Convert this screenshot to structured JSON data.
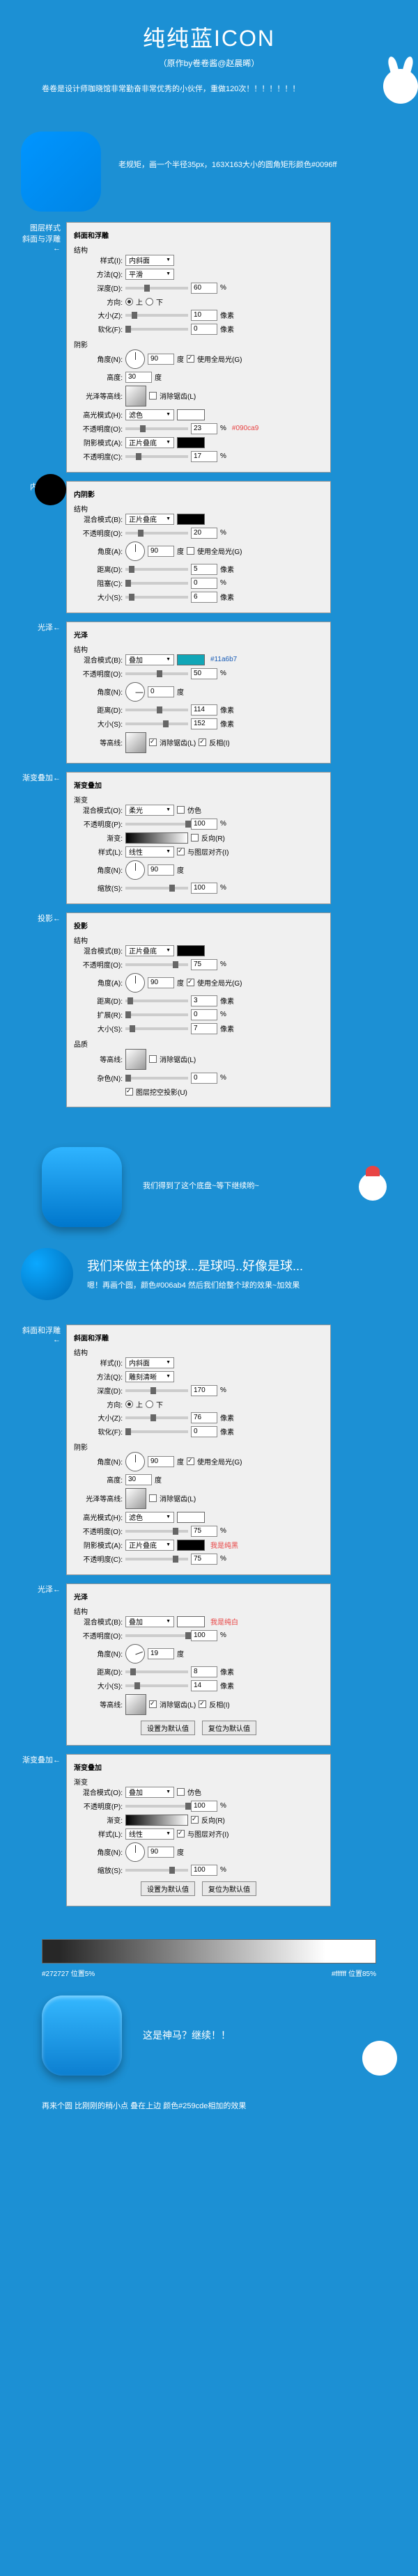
{
  "header": {
    "title": "纯纯蓝ICON",
    "subtitle": "（原作by卷卷酱@赵晨晞）"
  },
  "intro": {
    "text": "卷卷是设计师咖晓馆非常勤奋非常优秀的小伙伴，重做120次！！！！！！！"
  },
  "step1": {
    "desc": "老规矩，画一个半径35px，163X163大小的圆角矩形颜色#0096ff"
  },
  "labels": {
    "bevel": "图层样式\n斜面与浮雕←",
    "inner": "内阴影←",
    "glow": "光泽←",
    "grad": "渐变叠加←",
    "drop": "投影←",
    "bevel2": "斜面和浮雕←",
    "glow2": "光泽←",
    "grad2": "渐变叠加←"
  },
  "panel_bevel": {
    "title": "斜面和浮雕",
    "sec1": "结构",
    "style_l": "样式(I):",
    "style_v": "内斜面",
    "method_l": "方法(Q):",
    "method_v": "平滑",
    "depth_l": "深度(D):",
    "depth_v": "60",
    "depth_u": "%",
    "dir_l": "方向:",
    "up": "上",
    "down": "下",
    "size_l": "大小(Z):",
    "size_v": "10",
    "size_u": "像素",
    "soft_l": "软化(F):",
    "soft_v": "0",
    "soft_u": "像素",
    "sec2": "阴影",
    "angle_l": "角度(N):",
    "angle_v": "90",
    "angle_u": "度",
    "global": "使用全局光(G)",
    "alt_l": "高度:",
    "alt_v": "30",
    "alt_u": "度",
    "gloss_l": "光泽等高线:",
    "anti": "消除锯齿(L)",
    "hl_mode_l": "高光模式(H):",
    "hl_mode_v": "滤色",
    "hl_op_l": "不透明度(O):",
    "hl_op_v": "23",
    "hl_op_u": "%",
    "hl_note": "#090ca9",
    "sh_mode_l": "阴影模式(A):",
    "sh_mode_v": "正片叠底",
    "sh_op_l": "不透明度(C):",
    "sh_op_v": "17",
    "sh_op_u": "%"
  },
  "panel_inner": {
    "title": "内阴影",
    "sec": "结构",
    "mode_l": "混合模式(B):",
    "mode_v": "正片叠底",
    "op_l": "不透明度(O):",
    "op_v": "20",
    "op_u": "%",
    "angle_l": "角度(A):",
    "angle_v": "90",
    "angle_u": "度",
    "global": "使用全局光(G)",
    "dist_l": "距离(D):",
    "dist_v": "5",
    "dist_u": "像素",
    "choke_l": "阻塞(C):",
    "choke_v": "0",
    "choke_u": "%",
    "size_l": "大小(S):",
    "size_v": "6",
    "size_u": "像素"
  },
  "panel_glow": {
    "title": "光泽",
    "sec": "结构",
    "mode_l": "混合模式(B):",
    "mode_v": "叠加",
    "note": "#11a6b7",
    "op_l": "不透明度(O):",
    "op_v": "50",
    "op_u": "%",
    "angle_l": "角度(N):",
    "angle_v": "0",
    "angle_u": "度",
    "dist_l": "距离(D):",
    "dist_v": "114",
    "dist_u": "像素",
    "size_l": "大小(S):",
    "size_v": "152",
    "size_u": "像素",
    "cont_l": "等高线:",
    "anti": "消除锯齿(L)",
    "inv": "反相(I)"
  },
  "panel_grad": {
    "title": "渐变叠加",
    "sec": "渐变",
    "mode_l": "混合模式(O):",
    "mode_v": "柔光",
    "dither": "仿色",
    "op_l": "不透明度(P):",
    "op_v": "100",
    "op_u": "%",
    "grad_l": "渐变:",
    "rev": "反向(R)",
    "style_l": "样式(L):",
    "style_v": "线性",
    "align": "与图层对齐(I)",
    "angle_l": "角度(N):",
    "angle_v": "90",
    "angle_u": "度",
    "scale_l": "缩放(S):",
    "scale_v": "100",
    "scale_u": "%"
  },
  "panel_drop": {
    "title": "投影",
    "sec1": "结构",
    "mode_l": "混合模式(B):",
    "mode_v": "正片叠底",
    "op_l": "不透明度(O):",
    "op_v": "75",
    "op_u": "%",
    "angle_l": "角度(A):",
    "angle_v": "90",
    "angle_u": "度",
    "global": "使用全局光(G)",
    "dist_l": "距离(D):",
    "dist_v": "3",
    "dist_u": "像素",
    "spread_l": "扩展(R):",
    "spread_v": "0",
    "spread_u": "%",
    "size_l": "大小(S):",
    "size_v": "7",
    "size_u": "像素",
    "sec2": "品质",
    "cont_l": "等高线:",
    "anti": "消除锯齿(L)",
    "noise_l": "杂色(N):",
    "noise_v": "0",
    "noise_u": "%",
    "knock": "图层挖空投影(U)"
  },
  "combo1": {
    "text": "我们得到了这个底盘~等下继续哟~"
  },
  "section2": {
    "title": "我们来做主体的球...是球吗..好像是球...",
    "sub": "嗯！再画个圆，颜色#006ab4  然后我们给整个球的效果~加效果"
  },
  "panel_bevel2": {
    "title": "斜面和浮雕",
    "sec1": "结构",
    "style_l": "样式(I):",
    "style_v": "内斜面",
    "method_l": "方法(Q):",
    "method_v": "雕刻清晰",
    "depth_l": "深度(D):",
    "depth_v": "170",
    "depth_u": "%",
    "dir_l": "方向:",
    "up": "上",
    "down": "下",
    "size_l": "大小(Z):",
    "size_v": "76",
    "size_u": "像素",
    "soft_l": "软化(F):",
    "soft_v": "0",
    "soft_u": "像素",
    "sec2": "阴影",
    "angle_l": "角度(N):",
    "angle_v": "90",
    "angle_u": "度",
    "global": "使用全局光(G)",
    "alt_l": "高度:",
    "alt_v": "30",
    "alt_u": "度",
    "gloss_l": "光泽等高线:",
    "anti": "消除锯齿(L)",
    "hl_mode_l": "高光模式(H):",
    "hl_mode_v": "滤色",
    "hl_op_l": "不透明度(O):",
    "hl_op_v": "75",
    "hl_op_u": "%",
    "sh_mode_l": "阴影模式(A):",
    "sh_mode_v": "正片叠底",
    "sh_op_l": "不透明度(C):",
    "sh_op_v": "75",
    "sh_op_u": "%",
    "note": "我是纯黑"
  },
  "panel_glow2": {
    "title": "光泽",
    "sec": "结构",
    "mode_l": "混合模式(B):",
    "mode_v": "叠加",
    "note": "我是纯白",
    "op_l": "不透明度(O):",
    "op_v": "100",
    "op_u": "%",
    "angle_l": "角度(N):",
    "angle_v": "19",
    "angle_u": "度",
    "dist_l": "距离(D):",
    "dist_v": "8",
    "dist_u": "像素",
    "size_l": "大小(S):",
    "size_v": "14",
    "size_u": "像素",
    "cont_l": "等高线:",
    "anti": "消除锯齿(L)",
    "inv": "反相(I)",
    "btn1": "设置为默认值",
    "btn2": "复位为默认值"
  },
  "panel_grad2": {
    "title": "渐变叠加",
    "sec": "渐变",
    "mode_l": "混合模式(O):",
    "mode_v": "叠加",
    "dither": "仿色",
    "op_l": "不透明度(P):",
    "op_v": "100",
    "op_u": "%",
    "grad_l": "渐变:",
    "rev": "反向(R)",
    "style_l": "样式(L):",
    "style_v": "线性",
    "align": "与图层对齐(I)",
    "angle_l": "角度(N):",
    "angle_v": "90",
    "angle_u": "度",
    "scale_l": "缩放(S):",
    "scale_v": "100",
    "scale_u": "%",
    "btn1": "设置为默认值",
    "btn2": "复位为默认值"
  },
  "gradient": {
    "left": "#272727 位置5%",
    "right": "#ffffff 位置85%"
  },
  "final": {
    "text": "这是神马？继续！！"
  },
  "outro": {
    "text": "再来个圆 比刚刚的稍小点 叠在上边   颜色#259cde相加的效果"
  }
}
